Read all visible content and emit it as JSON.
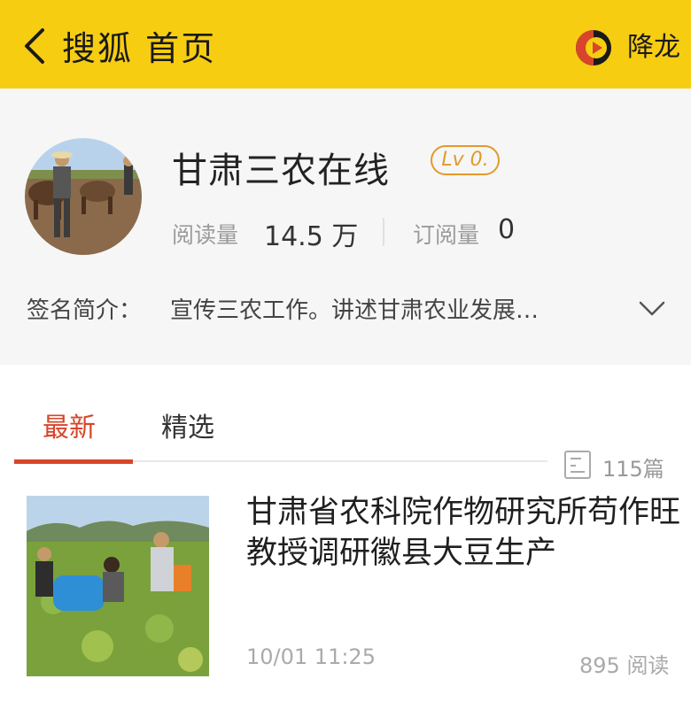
{
  "header": {
    "title": "搜狐 首页",
    "user_name": "降龙"
  },
  "profile": {
    "name": "甘肃三农在线",
    "level": "Lv 0.",
    "stats": {
      "reads_label": "阅读量",
      "reads_value": "14.5 万",
      "subs_label": "订阅量",
      "subs_value": "0"
    },
    "bio_label": "签名简介：",
    "bio_text": "宣传三农工作。讲述甘肃农业发展…"
  },
  "tabs": [
    {
      "label": "最新",
      "active": true
    },
    {
      "label": "精选",
      "active": false
    }
  ],
  "article_count": "115篇",
  "articles": [
    {
      "title": "甘肃省农科院作物研究所苟作旺教授调研徽县大豆生产",
      "time": "10/01 11:25",
      "reads": "895 阅读"
    }
  ],
  "colors": {
    "header_bg": "#f7cd12",
    "accent": "#d8452a",
    "level_badge": "#e29a2a"
  },
  "icons": [
    "back-arrow-icon",
    "video-play-icon",
    "chevron-down-icon",
    "document-icon"
  ]
}
